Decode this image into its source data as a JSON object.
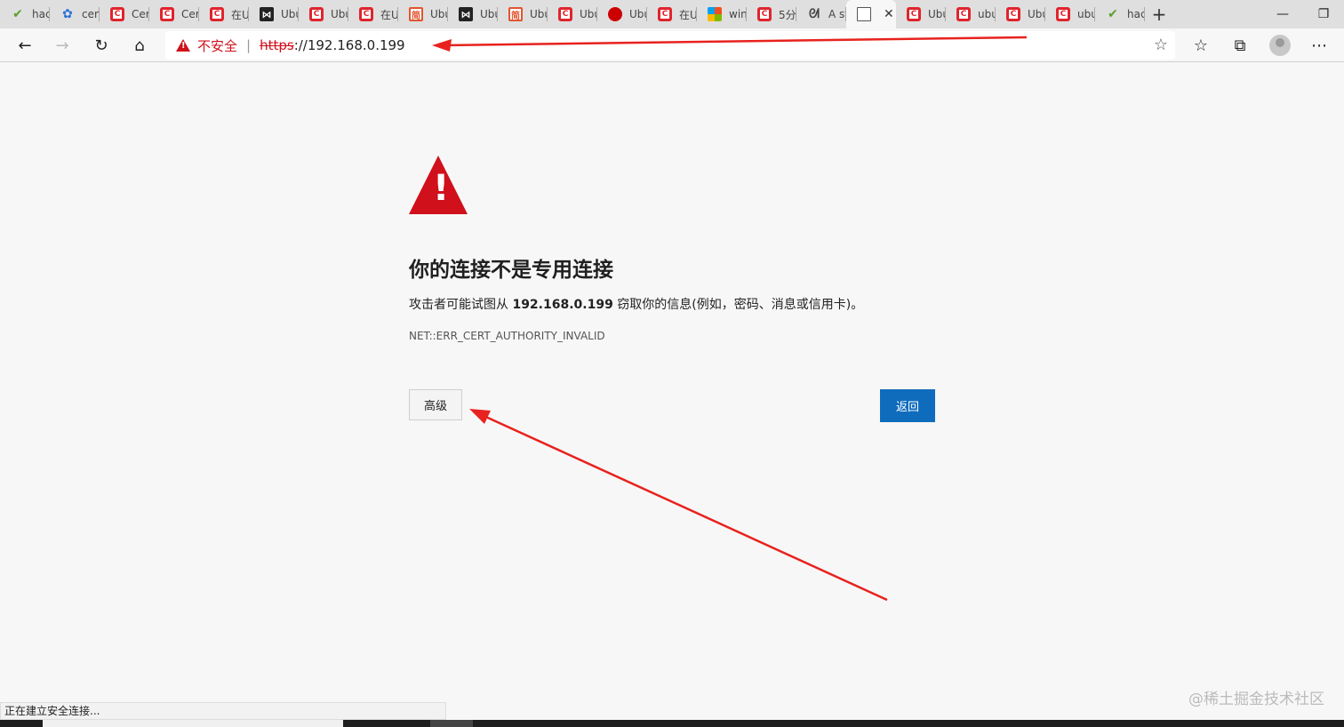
{
  "tabs": [
    {
      "label": "hac",
      "icon": "check-leaf-icon",
      "style": "green"
    },
    {
      "label": "cen",
      "icon": "paw-icon",
      "style": "blue"
    },
    {
      "label": "Cer",
      "icon": "c-logo-icon",
      "style": "red"
    },
    {
      "label": "Cer",
      "icon": "c-logo-icon",
      "style": "red"
    },
    {
      "label": "在U",
      "icon": "c-logo-icon",
      "style": "red"
    },
    {
      "label": "Ubu",
      "icon": "bowtie-icon",
      "style": "dark"
    },
    {
      "label": "Ubu",
      "icon": "c-logo-icon",
      "style": "red"
    },
    {
      "label": "在U",
      "icon": "c-logo-icon",
      "style": "red"
    },
    {
      "label": "Ubu",
      "icon": "jian-icon",
      "style": "orange"
    },
    {
      "label": "Ubu",
      "icon": "bowtie-icon",
      "style": "dark"
    },
    {
      "label": "Ubu",
      "icon": "jian-icon",
      "style": "orange"
    },
    {
      "label": "Ubu",
      "icon": "c-logo-icon",
      "style": "red"
    },
    {
      "label": "Ubu",
      "icon": "redhat-icon",
      "style": "redhat"
    },
    {
      "label": "在U",
      "icon": "c-logo-icon",
      "style": "red"
    },
    {
      "label": "win",
      "icon": "microsoft-icon",
      "style": "ms"
    },
    {
      "label": "5分",
      "icon": "c-logo-icon",
      "style": "red"
    },
    {
      "label": "A st",
      "icon": "swirl-icon",
      "style": "glyph"
    },
    {
      "label": "",
      "icon": "page-icon",
      "style": "page",
      "active": true
    },
    {
      "label": "Ubu",
      "icon": "c-logo-icon",
      "style": "red"
    },
    {
      "label": "ubu",
      "icon": "c-logo-icon",
      "style": "red"
    },
    {
      "label": "Ubu",
      "icon": "c-logo-icon",
      "style": "red"
    },
    {
      "label": "ubu",
      "icon": "c-logo-icon",
      "style": "red"
    },
    {
      "label": "hac",
      "icon": "check-leaf-icon",
      "style": "green"
    }
  ],
  "address": {
    "security_label": "不安全",
    "separator": "|",
    "scheme": "https",
    "rest": "://192.168.0.199"
  },
  "error": {
    "title": "你的连接不是专用连接",
    "desc_prefix": "攻击者可能试图从 ",
    "desc_host": "192.168.0.199",
    "desc_suffix": " 窃取你的信息(例如，密码、消息或信用卡)。",
    "code": "NET::ERR_CERT_AUTHORITY_INVALID",
    "advanced_label": "高级",
    "back_label": "返回"
  },
  "status_text": "正在建立安全连接...",
  "watermark": "@稀土掘金技术社区",
  "colors": {
    "warning_red": "#d0101b",
    "primary_blue": "#0f6cbd",
    "annotation_red": "#e8221e"
  }
}
